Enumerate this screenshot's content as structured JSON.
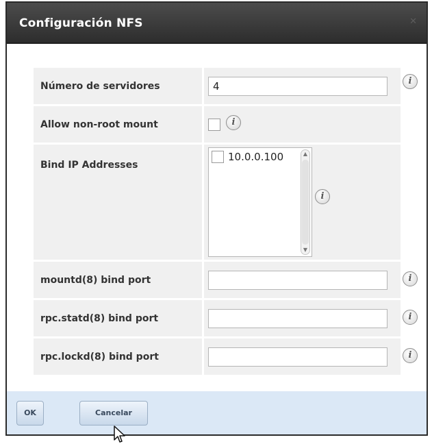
{
  "dialog": {
    "title": "Configuración NFS",
    "close_glyph": "✕"
  },
  "form": {
    "servers": {
      "label": "Número de servidores",
      "value": "4"
    },
    "allow_nonroot": {
      "label": "Allow non-root mount",
      "checked": false
    },
    "bind_ip": {
      "label": "Bind IP Addresses",
      "items": [
        "10.0.0.100"
      ]
    },
    "mountd_port": {
      "label": "mountd(8) bind port",
      "value": ""
    },
    "statd_port": {
      "label": "rpc.statd(8) bind port",
      "value": ""
    },
    "lockd_port": {
      "label": "rpc.lockd(8) bind port",
      "value": ""
    }
  },
  "info_glyph": "i",
  "footer": {
    "ok_label": "OK",
    "cancel_label": "Cancelar"
  },
  "colors": {
    "titlebar": "#3a3a3a",
    "footer": "#dbe8f6",
    "label_bg": "#f0f0f0"
  }
}
